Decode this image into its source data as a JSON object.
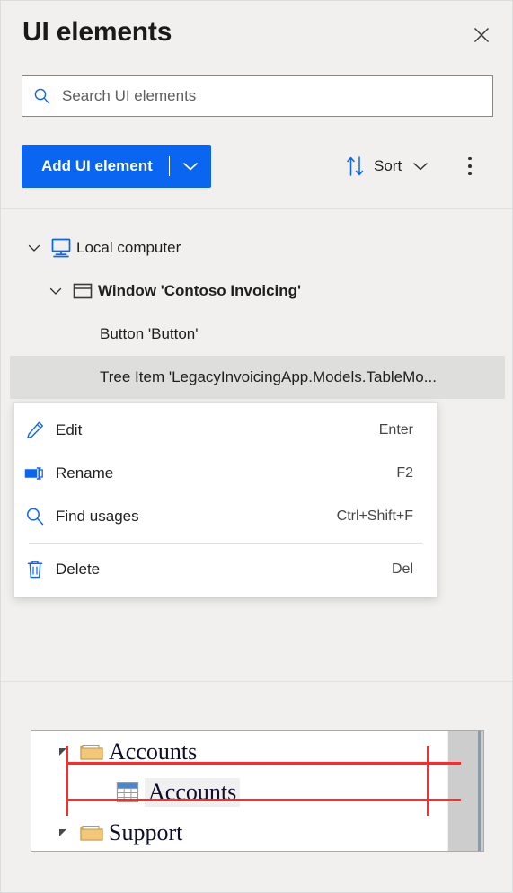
{
  "header": {
    "title": "UI elements",
    "close_icon": "close-icon"
  },
  "search": {
    "placeholder": "Search UI elements",
    "value": "",
    "icon": "search-icon"
  },
  "toolbar": {
    "add_button_label": "Add UI element",
    "add_button_caret_icon": "chevron-down-icon",
    "sort_label": "Sort",
    "sort_icon": "sort-arrows-icon",
    "sort_caret_icon": "chevron-down-icon",
    "more_icon": "more-vertical-icon",
    "accent_color": "#0a65f0"
  },
  "tree": {
    "items": [
      {
        "label": "Local computer",
        "icon": "monitor-icon",
        "chevron": "chevron-down-icon",
        "bold": false,
        "selected": false
      },
      {
        "label": "Window 'Contoso Invoicing'",
        "icon": "window-icon",
        "chevron": "chevron-down-icon",
        "bold": true,
        "selected": false
      },
      {
        "label": "Button 'Button'",
        "icon": "",
        "chevron": "",
        "bold": false,
        "selected": false
      },
      {
        "label": "Tree Item 'LegacyInvoicingApp.Models.TableMo...",
        "icon": "",
        "chevron": "",
        "bold": false,
        "selected": true
      }
    ]
  },
  "context_menu": {
    "items": [
      {
        "label": "Edit",
        "shortcut": "Enter",
        "icon": "pencil-icon"
      },
      {
        "label": "Rename",
        "shortcut": "F2",
        "icon": "rename-icon"
      },
      {
        "label": "Find usages",
        "shortcut": "Ctrl+Shift+F",
        "icon": "search-icon"
      },
      {
        "label": "Delete",
        "shortcut": "Del",
        "icon": "trash-icon"
      }
    ],
    "separator_after_index": 2
  },
  "preview": {
    "annotation_color": "#ff2a2a",
    "rows": [
      {
        "label": "Accounts",
        "icon": "folder-icon",
        "expander": "triangle-expanded-icon",
        "selected": false
      },
      {
        "label": "Accounts",
        "icon": "table-icon",
        "expander": "",
        "selected": true
      },
      {
        "label": "Support",
        "icon": "folder-icon",
        "expander": "triangle-expanded-icon",
        "selected": false
      }
    ]
  }
}
